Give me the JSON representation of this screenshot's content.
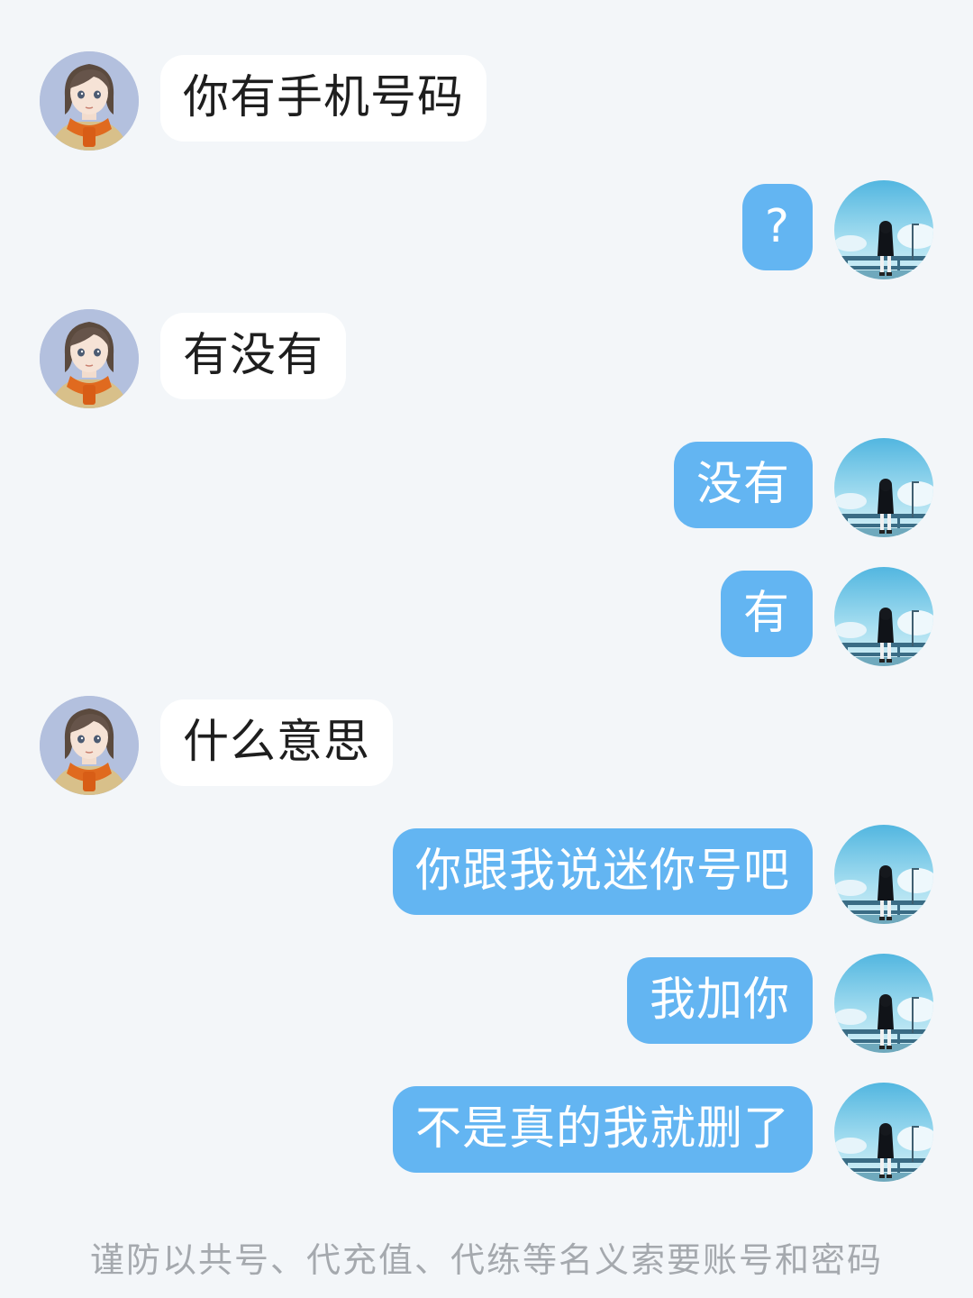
{
  "messages": [
    {
      "side": "in",
      "text": "你有手机号码"
    },
    {
      "side": "out",
      "text": "?"
    },
    {
      "side": "in",
      "text": "有没有"
    },
    {
      "side": "out",
      "text": "没有"
    },
    {
      "side": "out",
      "text": "有"
    },
    {
      "side": "in",
      "text": "什么意思"
    },
    {
      "side": "out",
      "text": "你跟我说迷你号吧"
    },
    {
      "side": "out",
      "text": "我加你"
    },
    {
      "side": "out",
      "text": "不是真的我就删了"
    }
  ],
  "notice": {
    "line1": "谨防以共号、代充值、代练等名义索要账号和密码"
  },
  "colors": {
    "background": "#f3f6f9",
    "incoming_bubble": "#ffffff",
    "outgoing_bubble": "#63b5f2",
    "notice_text": "#a5a9ae"
  },
  "icons": {
    "incoming_avatar": "avatar-icon-girl-orange-scarf",
    "outgoing_avatar": "avatar-icon-girl-sky-railing"
  }
}
